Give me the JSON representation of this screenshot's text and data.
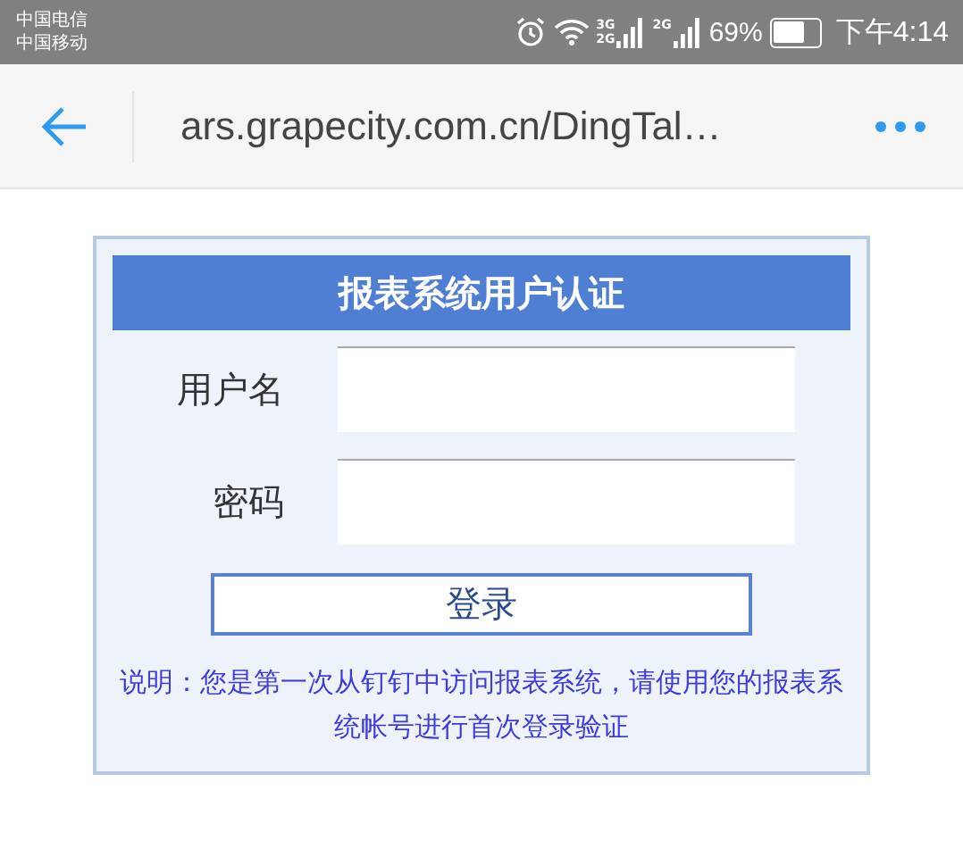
{
  "status_bar": {
    "carriers": [
      "中国电信",
      "中国移动"
    ],
    "signals": [
      {
        "labels": [
          "3G",
          "2G"
        ]
      },
      {
        "labels": [
          "2G"
        ]
      }
    ],
    "battery_percent": "69%",
    "time": "下午4:14"
  },
  "nav_bar": {
    "url": "ars.grapecity.com.cn/DingTal…"
  },
  "login": {
    "title": "报表系统用户认证",
    "fields": [
      {
        "label": "用户名"
      },
      {
        "label": "密码"
      }
    ],
    "button": "登录",
    "note": "说明：您是第一次从钉钉中访问报表系统，请使用您的报表系统帐号进行首次登录验证"
  }
}
